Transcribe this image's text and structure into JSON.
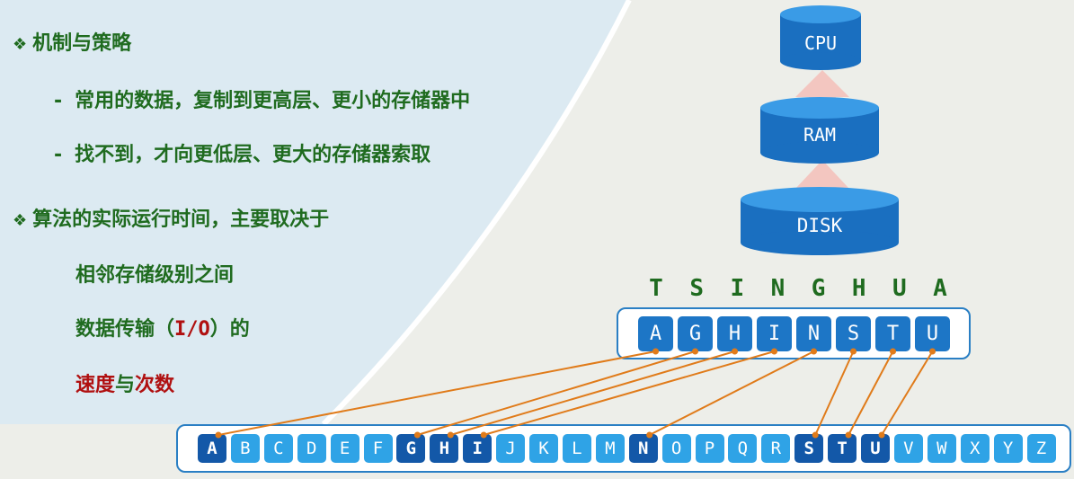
{
  "bullets": {
    "b1": "机制与策略",
    "b1_sub1": "常用的数据，复制到更高层、更小的存储器中",
    "b1_sub2": "找不到，才向更低层、更大的存储器索取",
    "b2": "算法的实际运行时间，主要取决于",
    "b2_line1": "相邻存储级别之间",
    "b2_line2_a": "数据传输（",
    "b2_line2_io": "I/O",
    "b2_line2_b": "）的",
    "b2_line3_a": "速度",
    "b2_line3_b": "与",
    "b2_line3_c": "次数",
    "mark": "❖",
    "dash": "-"
  },
  "hierarchy": {
    "levels": [
      "CPU",
      "RAM",
      "DISK"
    ]
  },
  "word": [
    "T",
    "S",
    "I",
    "N",
    "G",
    "H",
    "U",
    "A"
  ],
  "sorted_set": [
    "A",
    "G",
    "H",
    "I",
    "N",
    "S",
    "T",
    "U"
  ],
  "alphabet": [
    "A",
    "B",
    "C",
    "D",
    "E",
    "F",
    "G",
    "H",
    "I",
    "J",
    "K",
    "L",
    "M",
    "N",
    "O",
    "P",
    "Q",
    "R",
    "S",
    "T",
    "U",
    "V",
    "W",
    "X",
    "Y",
    "Z"
  ],
  "colors": {
    "text_green": "#1f6b1f",
    "text_red": "#b01010",
    "key_blue": "#1d76c6",
    "key_light": "#2fa3e6",
    "link_orange": "#e07b1a"
  }
}
